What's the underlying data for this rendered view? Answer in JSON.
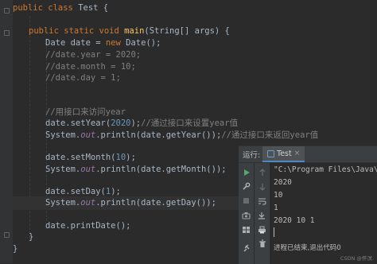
{
  "code": {
    "class_decl": {
      "kw": "public class ",
      "name": "Test",
      "brace": " {"
    },
    "main_decl": {
      "kw": "public static void ",
      "fn": "main",
      "args": "(String[] args) {"
    },
    "new_date": {
      "pre": "Date date = ",
      "kw": "new ",
      "post": "Date();"
    },
    "comment_year": "//date.year = 2020;",
    "comment_month": "//date.month = 10;",
    "comment_day": "//date.day = 1;",
    "comment_iface": "//用接口来访问year",
    "set_year": {
      "pre": "date.setYear(",
      "num": "2020",
      "post": ");",
      "comment": "//通过接口来设置year值"
    },
    "print_year": {
      "pre": "System.",
      "fld": "out",
      "post": ".println(date.getYear());",
      "comment": "//通过接口来返回year值"
    },
    "set_month": {
      "pre": "date.setMonth(",
      "num": "10",
      "post": ");"
    },
    "print_month": {
      "pre": "System.",
      "fld": "out",
      "post": ".println(date.getMonth());"
    },
    "set_day": {
      "pre": "date.setDay(",
      "num": "1",
      "post": ");"
    },
    "print_day": {
      "pre": "System.",
      "fld": "out",
      "post": ".println(date.getDay());"
    },
    "print_date": "date.printDate();",
    "close_brace": "}"
  },
  "run_panel": {
    "label": "运行:",
    "tab_name": "Test",
    "tab_close": "×",
    "output": [
      "\"C:\\Program Files\\Java\\j",
      "2020",
      "10",
      "1",
      "2020 10 1",
      "",
      "进程已结束,退出代码0"
    ]
  },
  "icons": [
    "run-icon",
    "stop-icon",
    "wrench-icon",
    "camera-icon",
    "layout-icon",
    "pin-icon",
    "up-arrow-icon",
    "down-arrow-icon",
    "soft-wrap-icon",
    "scroll-end-icon",
    "print-icon",
    "trash-icon"
  ],
  "watermark": "CSDN @怀溟.",
  "colors": {
    "keyword": "#cc7832",
    "method": "#ffc66d",
    "number": "#6897bb",
    "comment": "#808080",
    "field": "#9876aa",
    "text": "#a9b7c6",
    "run_green": "#59a869"
  }
}
